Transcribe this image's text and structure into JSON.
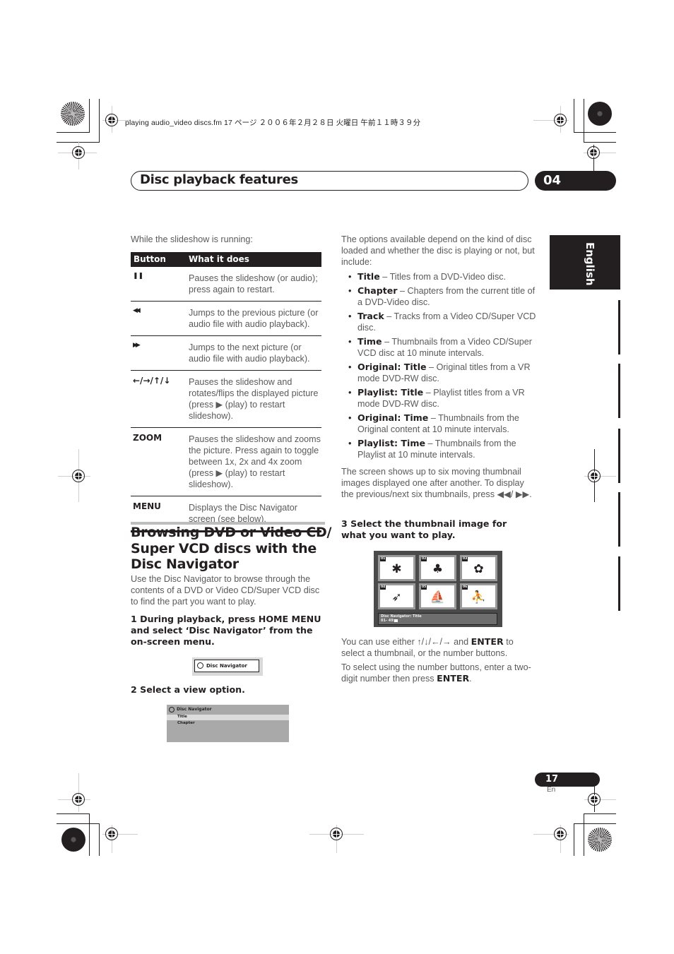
{
  "slug_line": "playing audio_video discs.fm  17 ページ  ２００６年２月２８日  火曜日  午前１１時３９分",
  "header": {
    "title": "Disc playback features",
    "chapter_number": "04"
  },
  "language_tab": "English",
  "left_column": {
    "intro": "While the slideshow is running:",
    "table": {
      "headers": [
        "Button",
        "What it does"
      ],
      "rows": [
        {
          "button": "❚❚",
          "button_icon": "pause-icon",
          "desc": "Pauses the slideshow (or audio); press again to restart."
        },
        {
          "button": "◀◀",
          "button_icon": "previous-icon",
          "desc": "Jumps to the previous picture (or audio file with audio playback)."
        },
        {
          "button": "▶▶",
          "button_icon": "next-icon",
          "desc": "Jumps to the next picture (or audio file with audio playback)."
        },
        {
          "button": "←/→/↑/↓",
          "button_icon": "arrow-keys-icon",
          "desc": "Pauses the slideshow and rotates/flips the displayed picture (press ▶ (play) to restart slideshow)."
        },
        {
          "button": "ZOOM",
          "button_icon": "",
          "desc": "Pauses the slideshow and zooms the picture. Press again to toggle between 1x, 2x and 4x zoom (press ▶ (play) to restart slideshow)."
        },
        {
          "button": "MENU",
          "button_icon": "",
          "desc": "Displays the Disc Navigator screen (see below)."
        }
      ]
    },
    "section_title": "Browsing DVD or Video CD/ Super VCD discs with the Disc Navigator",
    "section_intro": "Use the Disc Navigator to browse through the contents of a DVD or Video CD/Super VCD disc to find the part you want to play.",
    "step1": "1    During playback, press HOME MENU and select ‘Disc Navigator’ from the on-screen menu.",
    "disc_nav_button": "Disc Navigator",
    "step2": "2    Select a view option.",
    "menu_screen": {
      "title": "Disc Navigator",
      "items": [
        "Title",
        "Chapter"
      ],
      "selected": "Title"
    }
  },
  "right_column": {
    "intro": "The options available depend on the kind of disc loaded and whether the disc is playing or not, but include:",
    "options": [
      {
        "term": "Title",
        "desc": " – Titles from a DVD-Video disc."
      },
      {
        "term": "Chapter",
        "desc": " – Chapters from the current title of a DVD-Video disc."
      },
      {
        "term": "Track",
        "desc": " – Tracks from a Video CD/Super VCD disc."
      },
      {
        "term": "Time",
        "desc": " – Thumbnails from a Video CD/Super VCD disc at 10 minute intervals."
      },
      {
        "term": "Original: Title",
        "desc": " – Original titles from a VR mode DVD-RW disc."
      },
      {
        "term": "Playlist: Title",
        "desc": " – Playlist titles from a VR mode DVD-RW disc."
      },
      {
        "term": "Original: Time",
        "desc": " – Thumbnails from the Original content at 10 minute intervals."
      },
      {
        "term": "Playlist: Time",
        "desc": " – Thumbnails from the Playlist at 10 minute intervals."
      }
    ],
    "thumb_para": "The screen shows up to six moving thumbnail images displayed one after another. To display the previous/next six thumbnails, press ◀◀/ ▶▶.",
    "step3": "3    Select the thumbnail image for what you want to play.",
    "thumbnail_screen": {
      "thumbs": [
        {
          "num": "01",
          "icon": "leaf-icon",
          "glyph": "✱"
        },
        {
          "num": "02",
          "icon": "tree-icon",
          "glyph": "♣"
        },
        {
          "num": "03",
          "icon": "flower-icon",
          "glyph": "✿"
        },
        {
          "num": "04",
          "icon": "toucan-icon",
          "glyph": "➶"
        },
        {
          "num": "05",
          "icon": "windsurfer-icon",
          "glyph": "⛵"
        },
        {
          "num": "06",
          "icon": "skater-icon",
          "glyph": "⛹"
        }
      ],
      "status_title": "Disc Navigator: Title",
      "status_range": "01- 49:"
    },
    "select_para_1": {
      "pre": "You can use either ↑/↓/←/→ and ",
      "bold": "ENTER",
      "post": " to select a thumbnail, or the number buttons."
    },
    "select_para_2": {
      "pre": "To select using the number buttons, enter a two-digit number then press ",
      "bold": "ENTER",
      "post": "."
    }
  },
  "footer": {
    "page_number": "17",
    "language_code": "En"
  }
}
